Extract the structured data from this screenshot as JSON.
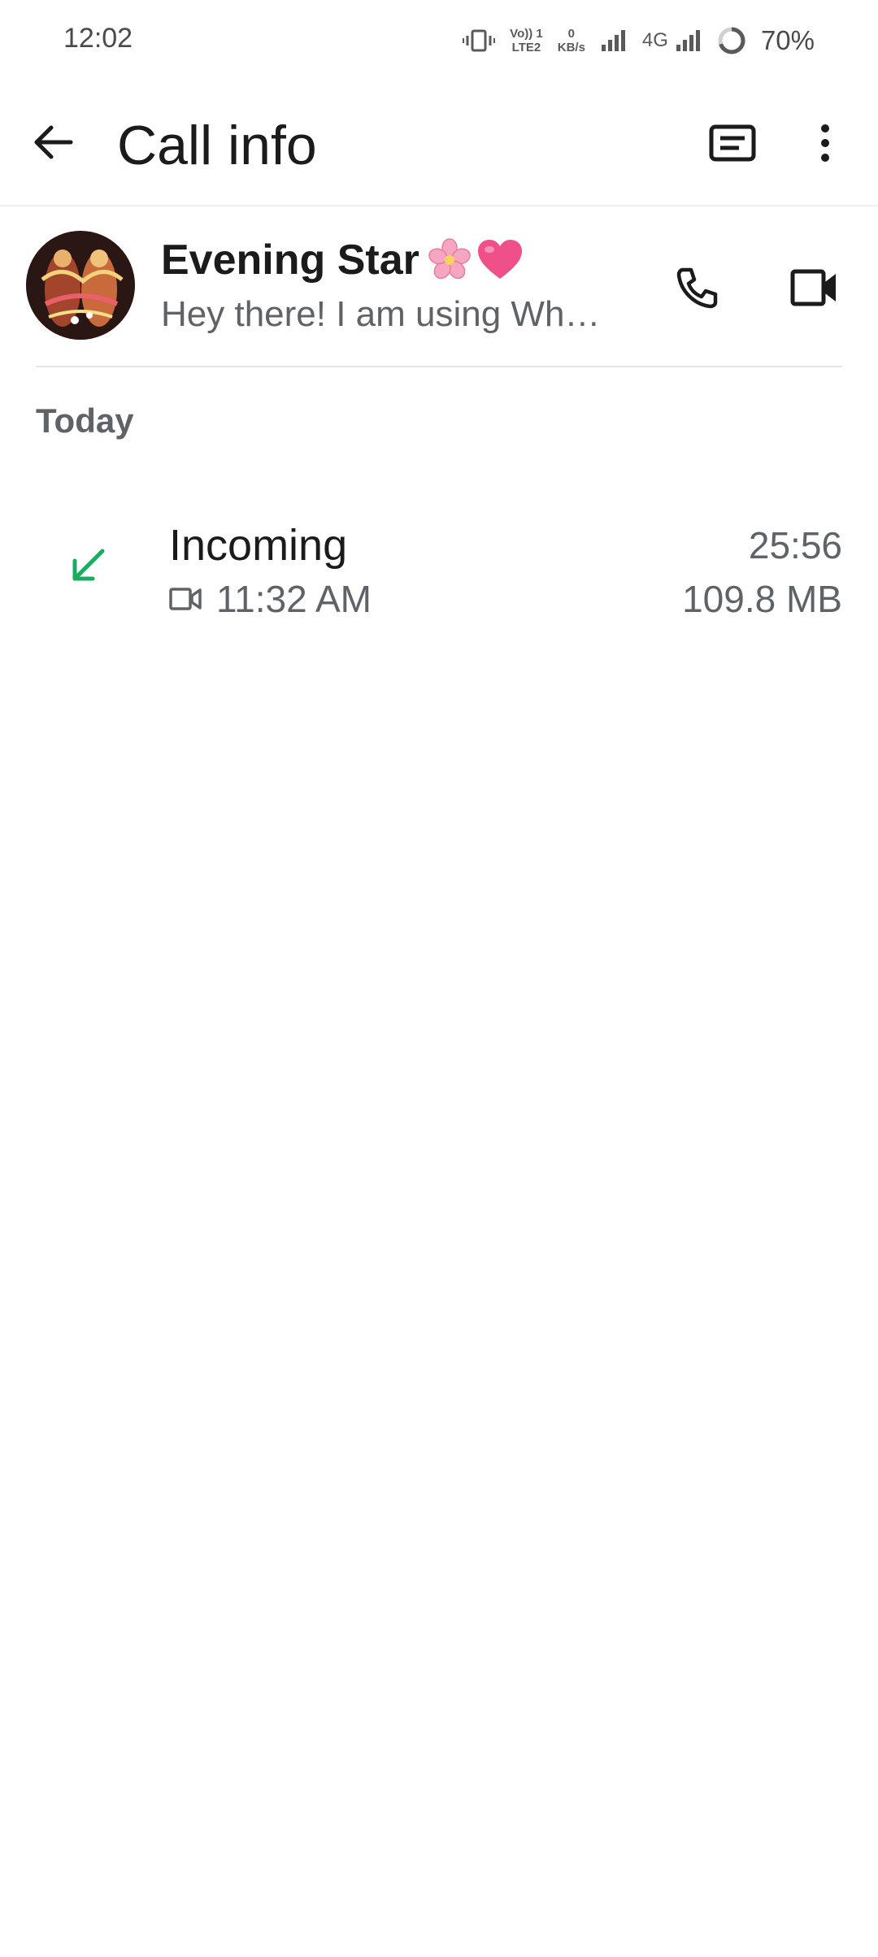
{
  "status_bar": {
    "time": "12:02",
    "volte_top": "Vo)) 1",
    "volte_bottom": "LTE2",
    "net_speed_value": "0",
    "net_speed_unit": "KB/s",
    "network_type": "4G",
    "battery_percent": "70%",
    "icons": [
      "vibrate-icon",
      "signal-icon",
      "signal-icon",
      "battery-ring-icon"
    ]
  },
  "app_bar": {
    "title": "Call info",
    "icons": [
      "back-arrow-icon",
      "message-icon",
      "more-vert-icon"
    ]
  },
  "contact": {
    "name": "Evening Star",
    "emojis": [
      "cherry-blossom-emoji",
      "pink-heart-emoji"
    ],
    "status": "Hey there! I am using Wh…",
    "actions": [
      "phone-icon",
      "video-camera-icon"
    ]
  },
  "section": {
    "title": "Today"
  },
  "calls": [
    {
      "type": "Incoming",
      "media_icon": "video-camera-icon",
      "time": "11:32 AM",
      "duration": "25:56",
      "size": "109.8 MB",
      "direction_icon": "incoming-arrow-icon"
    }
  ],
  "colors": {
    "incoming_arrow": "#1DAA61",
    "secondary_text": "#5f6368",
    "primary_text": "#1b1b1b",
    "divider": "#e6e6e6"
  }
}
